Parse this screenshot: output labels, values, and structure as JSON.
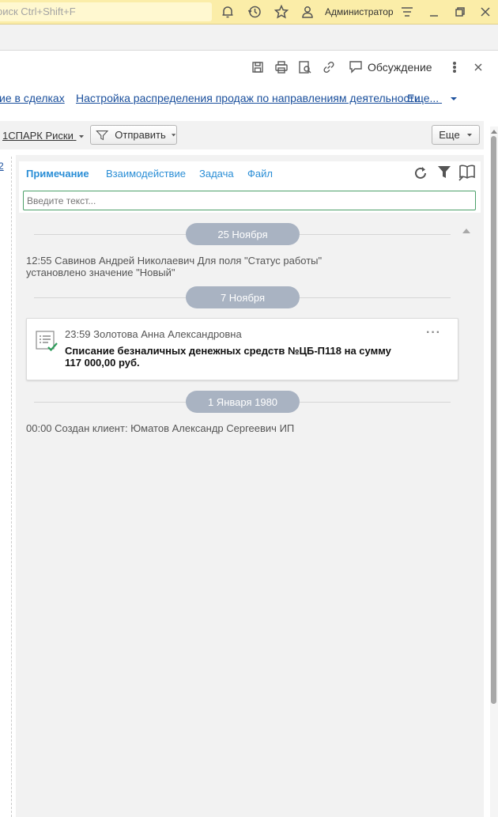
{
  "topbar": {
    "search_placeholder": "оиск Ctrl+Shift+F",
    "user_name": "Администратор",
    "icons": [
      "bell-icon",
      "history-icon",
      "star-icon",
      "users-icon",
      "menu-icon",
      "minimize-icon",
      "restore-icon",
      "close-icon"
    ]
  },
  "toolbar": {
    "discuss_label": "Обсуждение",
    "icons": [
      "save-icon",
      "print-icon",
      "preview-icon",
      "link-icon",
      "discussion-icon",
      "more-vert-icon",
      "close-icon"
    ]
  },
  "nav_links": {
    "deals": "ие в сделках",
    "sales_settings": "Настройка распределения продаж по направлениям деятельности",
    "more": "Еще..."
  },
  "action_bar": {
    "spark_label": "1СПАРК Риски",
    "send_label": "Отправить",
    "more_label": "Еще"
  },
  "left_panel": {
    "marker": "2"
  },
  "tabs": {
    "note": "Примечание",
    "interaction": "Взаимодействие",
    "task": "Задача",
    "file": "Файл"
  },
  "input": {
    "placeholder": "Введите текст..."
  },
  "feed": {
    "dates": [
      "25 Ноября",
      "7 Ноября",
      "1 Января 1980"
    ],
    "event1": {
      "line1": "12:55 Савинов Андрей Николаевич Для поля \"Статус работы\"",
      "line2": "установлено значение \"Новый\""
    },
    "card": {
      "title": "23:59 Золотова Анна Александровна",
      "body": "Списание безналичных денежных средств №ЦБ-П118 на сумму 117 000,00 руб.",
      "menu": "···"
    },
    "event3": "00:00 Создан клиент: Юматов Александр Сергеевич ИП"
  },
  "colors": {
    "topbar_bg": "#fbeda8",
    "link": "#1a4f9c",
    "tab": "#2a8ed6",
    "date_pill": "#a9b3c2",
    "input_border": "#4ca06a"
  }
}
